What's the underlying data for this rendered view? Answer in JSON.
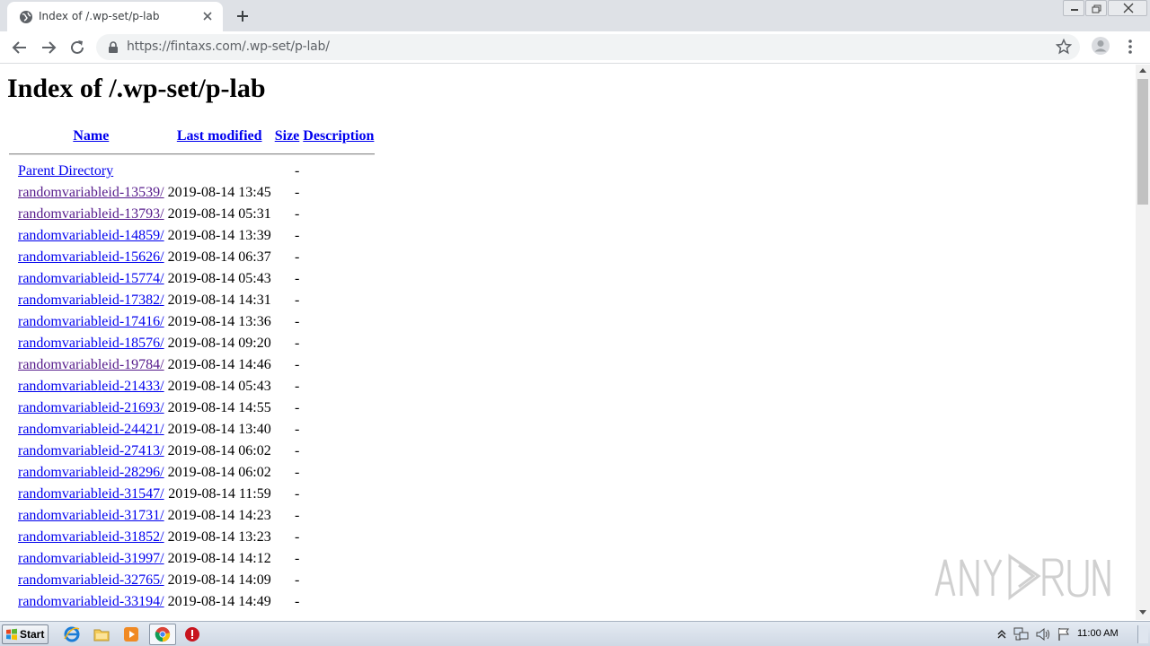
{
  "browser": {
    "tab_title": "Index of /.wp-set/p-lab",
    "url": "https://fintaxs.com/.wp-set/p-lab/"
  },
  "page": {
    "title": "Index of /.wp-set/p-lab",
    "headers": {
      "name": "Name",
      "last_modified": "Last modified",
      "size": "Size",
      "description": "Description"
    },
    "parent": {
      "name": "Parent Directory",
      "size": "-"
    },
    "rows": [
      {
        "name": "randomvariableid-13539/",
        "modified": "2019-08-14 13:45",
        "size": "-",
        "visited": true
      },
      {
        "name": "randomvariableid-13793/",
        "modified": "2019-08-14 05:31",
        "size": "-",
        "visited": true
      },
      {
        "name": "randomvariableid-14859/",
        "modified": "2019-08-14 13:39",
        "size": "-",
        "visited": false
      },
      {
        "name": "randomvariableid-15626/",
        "modified": "2019-08-14 06:37",
        "size": "-",
        "visited": false
      },
      {
        "name": "randomvariableid-15774/",
        "modified": "2019-08-14 05:43",
        "size": "-",
        "visited": false
      },
      {
        "name": "randomvariableid-17382/",
        "modified": "2019-08-14 14:31",
        "size": "-",
        "visited": false
      },
      {
        "name": "randomvariableid-17416/",
        "modified": "2019-08-14 13:36",
        "size": "-",
        "visited": false
      },
      {
        "name": "randomvariableid-18576/",
        "modified": "2019-08-14 09:20",
        "size": "-",
        "visited": false
      },
      {
        "name": "randomvariableid-19784/",
        "modified": "2019-08-14 14:46",
        "size": "-",
        "visited": true
      },
      {
        "name": "randomvariableid-21433/",
        "modified": "2019-08-14 05:43",
        "size": "-",
        "visited": false
      },
      {
        "name": "randomvariableid-21693/",
        "modified": "2019-08-14 14:55",
        "size": "-",
        "visited": false
      },
      {
        "name": "randomvariableid-24421/",
        "modified": "2019-08-14 13:40",
        "size": "-",
        "visited": false
      },
      {
        "name": "randomvariableid-27413/",
        "modified": "2019-08-14 06:02",
        "size": "-",
        "visited": false
      },
      {
        "name": "randomvariableid-28296/",
        "modified": "2019-08-14 06:02",
        "size": "-",
        "visited": false
      },
      {
        "name": "randomvariableid-31547/",
        "modified": "2019-08-14 11:59",
        "size": "-",
        "visited": false
      },
      {
        "name": "randomvariableid-31731/",
        "modified": "2019-08-14 14:23",
        "size": "-",
        "visited": false
      },
      {
        "name": "randomvariableid-31852/",
        "modified": "2019-08-14 13:23",
        "size": "-",
        "visited": false
      },
      {
        "name": "randomvariableid-31997/",
        "modified": "2019-08-14 14:12",
        "size": "-",
        "visited": false
      },
      {
        "name": "randomvariableid-32765/",
        "modified": "2019-08-14 14:09",
        "size": "-",
        "visited": false
      },
      {
        "name": "randomvariableid-33194/",
        "modified": "2019-08-14 14:49",
        "size": "-",
        "visited": false
      }
    ]
  },
  "taskbar": {
    "start_label": "Start",
    "clock": "11:00 AM"
  },
  "watermark": "ANY RUN",
  "colors": {
    "link": "#0000ee",
    "visited_link": "#551a8b",
    "tabstrip": "#dee1e6",
    "omnibox": "#f1f3f4"
  },
  "icons": [
    "globe-icon",
    "close-icon",
    "plus-icon",
    "back-arrow-icon",
    "forward-arrow-icon",
    "reload-icon",
    "lock-icon",
    "star-icon",
    "profile-icon",
    "kebab-menu-icon",
    "windows-flag-icon",
    "ie-icon",
    "folder-icon",
    "media-player-icon",
    "chrome-icon",
    "stop-icon",
    "speaker-icon",
    "network-icon",
    "flag-icon"
  ]
}
